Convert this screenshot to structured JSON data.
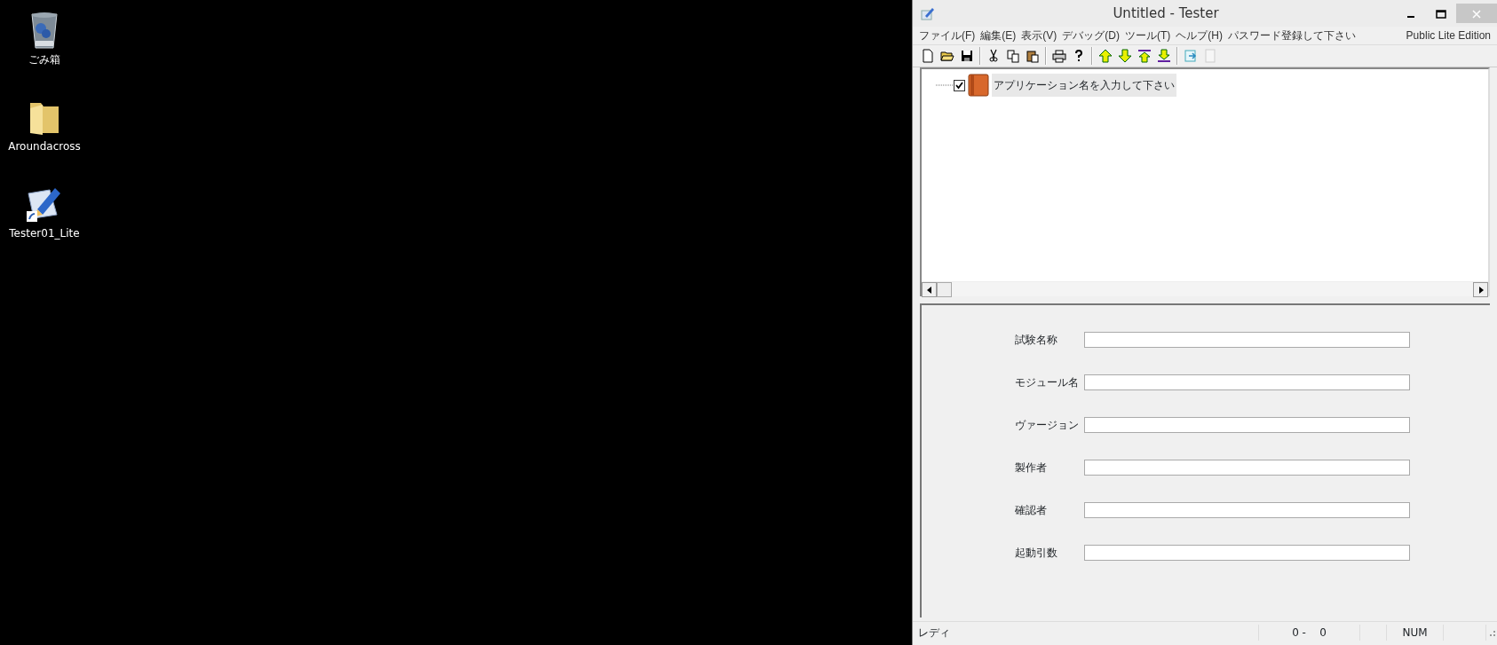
{
  "desktop_icons": [
    {
      "kind": "trash",
      "label": "ごみ箱"
    },
    {
      "kind": "folder",
      "label": "Aroundacross"
    },
    {
      "kind": "shortcut",
      "label": "Tester01_Lite"
    }
  ],
  "window": {
    "title": "Untitled - Tester"
  },
  "menu": {
    "items": [
      "ファイル(F)",
      "編集(E)",
      "表示(V)",
      "デバッグ(D)",
      "ツール(T)",
      "ヘルプ(H)",
      "パスワード登録して下さい"
    ],
    "edition": "Public Lite Edition"
  },
  "toolbar": [
    [
      {
        "kind": "new",
        "disabled": false
      },
      {
        "kind": "open",
        "disabled": false
      },
      {
        "kind": "save",
        "disabled": false
      }
    ],
    [
      {
        "kind": "cut",
        "disabled": false
      },
      {
        "kind": "copy",
        "disabled": false
      },
      {
        "kind": "paste",
        "disabled": false
      }
    ],
    [
      {
        "kind": "print",
        "disabled": false
      },
      {
        "kind": "help",
        "disabled": false
      }
    ],
    [
      {
        "kind": "up",
        "disabled": false
      },
      {
        "kind": "down",
        "disabled": false
      },
      {
        "kind": "top",
        "disabled": false
      },
      {
        "kind": "bottom",
        "disabled": false
      }
    ],
    [
      {
        "kind": "export",
        "disabled": false
      },
      {
        "kind": "blank",
        "disabled": true
      }
    ]
  ],
  "tree": {
    "items": [
      {
        "label": "アプリケーション名を入力して下さい",
        "checked": true,
        "selected": true
      }
    ]
  },
  "form": {
    "fields": [
      {
        "label": "試験名称"
      },
      {
        "label": "モジュール名"
      },
      {
        "label": "ヴァージョン"
      },
      {
        "label": "製作者"
      },
      {
        "label": "確認者"
      },
      {
        "label": "起動引数"
      }
    ]
  },
  "status_bar": {
    "message": "レディ",
    "position": "0 -    0",
    "indicator": "NUM"
  }
}
